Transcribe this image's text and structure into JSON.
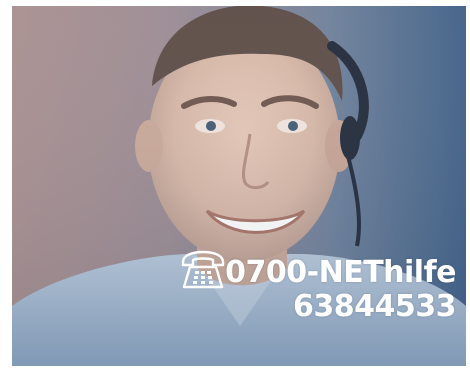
{
  "photo": {
    "subject": "smiling-man-with-headset",
    "colors": {
      "background_left": "#a88e8e",
      "background_right": "#3e5f86",
      "skin": "#d7b7a6",
      "hair": "#5b4a44",
      "shirt": "#9fb6cf",
      "headset": "#1f2838"
    }
  },
  "hotline": {
    "icon": "telephone-icon",
    "name": "0700-NEThilfe",
    "digits": "63844533",
    "text_color": "#ffffff"
  }
}
